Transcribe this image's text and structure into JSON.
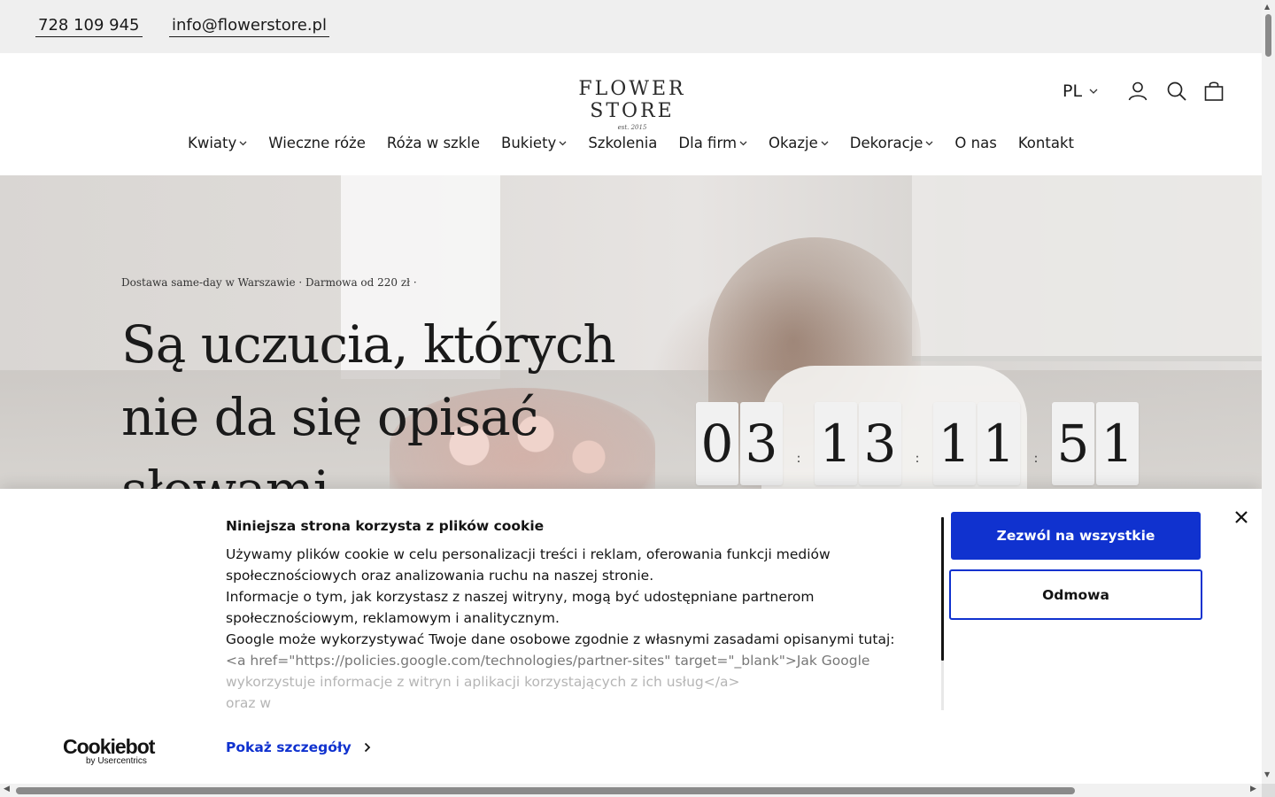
{
  "topbar": {
    "phone": "728 109 945",
    "email": "info@flowerstore.pl"
  },
  "header": {
    "logo_name": "FLOWER STORE",
    "logo_est": "est. 2015",
    "language": "PL",
    "icons": [
      "user-icon",
      "search-icon",
      "cart-icon"
    ]
  },
  "nav": [
    {
      "label": "Kwiaty",
      "dropdown": true
    },
    {
      "label": "Wieczne róże",
      "dropdown": false
    },
    {
      "label": "Róża w szkle",
      "dropdown": false
    },
    {
      "label": "Bukiety",
      "dropdown": true
    },
    {
      "label": "Szkolenia",
      "dropdown": false
    },
    {
      "label": "Dla firm",
      "dropdown": true
    },
    {
      "label": "Okazje",
      "dropdown": true
    },
    {
      "label": "Dekoracje",
      "dropdown": true
    },
    {
      "label": "O nas",
      "dropdown": false
    },
    {
      "label": "Kontakt",
      "dropdown": false
    }
  ],
  "hero": {
    "tagline": "Dostawa same-day w Warszawie · Darmowa od 220 zł ·",
    "headline": "Są uczucia, których nie da się opisać słowami",
    "countdown": {
      "days": [
        "0",
        "3"
      ],
      "hours": [
        "1",
        "3"
      ],
      "minutes": [
        "1",
        "1"
      ],
      "seconds": [
        "5",
        "1"
      ],
      "separator": ":"
    }
  },
  "cookie": {
    "title": "Niniejsza strona korzysta z plików cookie",
    "lines": [
      "Używamy plików cookie w celu personalizacji treści i reklam, oferowania funkcji mediów",
      "społecznościowych oraz analizowania ruchu na naszej stronie.",
      "Informacje o tym, jak korzystasz z naszej witryny, mogą być udostępniane partnerom",
      "społecznościowym, reklamowym i analitycznym.",
      "Google może wykorzystywać Twoje dane osobowe zgodnie z własnymi zasadami opisanymi tutaj:",
      "<a href=\"https://policies.google.com/technologies/partner-sites\" target=\"_blank\">Jak Google",
      "wykorzystuje informacje z witryn i aplikacji korzystających z ich usług</a>",
      "oraz w"
    ],
    "allow_label": "Zezwól na wszystkie",
    "deny_label": "Odmowa",
    "details_label": "Pokaż szczegóły",
    "brand": "Cookiebot",
    "brand_by": "by Usercentrics"
  },
  "colors": {
    "accent": "#1032cf",
    "topbar_bg": "#efefef",
    "text": "#1a1a1a"
  }
}
